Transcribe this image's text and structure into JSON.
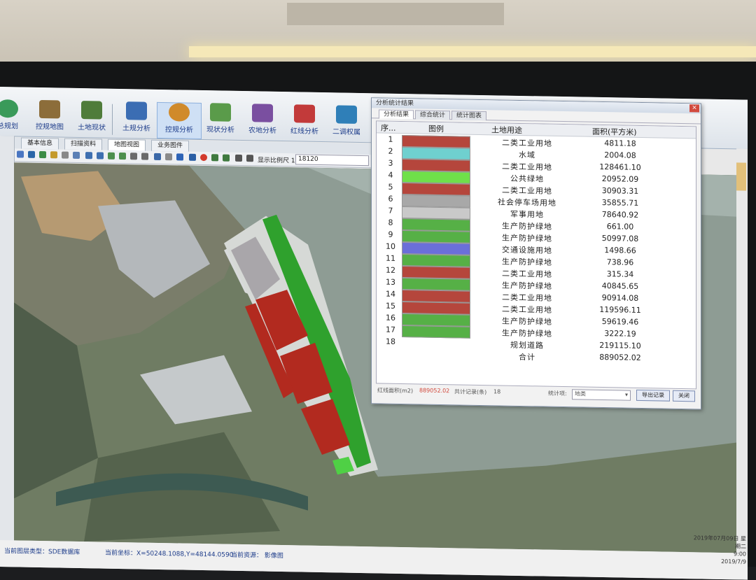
{
  "ribbon": {
    "buttons": [
      {
        "label": "总规划",
        "color": "#3a9a5a"
      },
      {
        "label": "控规地图",
        "color": "#8c6d3a"
      },
      {
        "label": "土地现状",
        "color": "#4f7c3a"
      },
      {
        "label": "土规分析",
        "color": "#3b6db3"
      },
      {
        "label": "控规分析",
        "color": "#d08a2b"
      },
      {
        "label": "现状分析",
        "color": "#5a9b4a"
      },
      {
        "label": "农地分析",
        "color": "#7a4fa0"
      },
      {
        "label": "红线分析",
        "color": "#c23a3a"
      },
      {
        "label": "二调权属",
        "color": "#2f7fb8"
      }
    ]
  },
  "tabs": [
    "基本信息",
    "扫描资料",
    "地图视图",
    "业务图件"
  ],
  "toolbar": {
    "scale_label": "显示比例尺 1:",
    "scale_value": "18120"
  },
  "dialog": {
    "title": "分析统计结果",
    "tabs": [
      "分析结果",
      "综合统计",
      "统计图表"
    ],
    "headers": {
      "seq": "序...",
      "legend": "图例",
      "use": "土地用途",
      "area": "面积(平方米)"
    },
    "rows": [
      {
        "seq": "1",
        "use": "二类工业用地",
        "area": "4811.18",
        "color": "#b5463c"
      },
      {
        "seq": "2",
        "use": "水域",
        "area": "2004.08",
        "color": "#6fd0cf"
      },
      {
        "seq": "3",
        "use": "二类工业用地",
        "area": "128461.10",
        "color": "#b5463c"
      },
      {
        "seq": "4",
        "use": "公共绿地",
        "area": "20952.09",
        "color": "#6fe04a"
      },
      {
        "seq": "5",
        "use": "二类工业用地",
        "area": "30903.31",
        "color": "#b5463c"
      },
      {
        "seq": "6",
        "use": "社会停车场用地",
        "area": "35855.71",
        "color": "#a8a8a8"
      },
      {
        "seq": "7",
        "use": "军事用地",
        "area": "78640.92",
        "color": "#c9c9c9"
      },
      {
        "seq": "8",
        "use": "生产防护绿地",
        "area": "661.00",
        "color": "#56b046"
      },
      {
        "seq": "9",
        "use": "生产防护绿地",
        "area": "50997.08",
        "color": "#56b046"
      },
      {
        "seq": "10",
        "use": "交通设施用地",
        "area": "1498.66",
        "color": "#6b6fd9"
      },
      {
        "seq": "11",
        "use": "生产防护绿地",
        "area": "738.96",
        "color": "#56b046"
      },
      {
        "seq": "12",
        "use": "二类工业用地",
        "area": "315.34",
        "color": "#b5463c"
      },
      {
        "seq": "13",
        "use": "生产防护绿地",
        "area": "40845.65",
        "color": "#56b046"
      },
      {
        "seq": "14",
        "use": "二类工业用地",
        "area": "90914.08",
        "color": "#b5463c"
      },
      {
        "seq": "15",
        "use": "二类工业用地",
        "area": "119596.11",
        "color": "#b5463c"
      },
      {
        "seq": "16",
        "use": "生产防护绿地",
        "area": "59619.46",
        "color": "#56b046"
      },
      {
        "seq": "17",
        "use": "生产防护绿地",
        "area": "3222.19",
        "color": "#56b046"
      },
      {
        "seq": "18",
        "use": "规划道路",
        "area": "219115.10",
        "color": ""
      },
      {
        "seq": "",
        "use": "合计",
        "area": "889052.02",
        "color": ""
      }
    ],
    "footer": {
      "left1": "红线面积(m2)",
      "left2": "889052.02",
      "left3": "共计记录(条)",
      "left4": "18",
      "stat_label": "统计项:",
      "stat_value": "地类",
      "export_label": "导出记录",
      "close_label": "关闭"
    }
  },
  "status": {
    "mode": "当前图层类型：SDE数据库",
    "coords": "当前坐标：X=50248.1088,Y=48144.0590",
    "layer": "当前资源：  影像图"
  },
  "clock": {
    "date": "2019年07月09日 星期二",
    "time": "9:00",
    "date2": "2019/7/9"
  },
  "map": {
    "water": "#8a9a92",
    "land": "#6d7c5f"
  }
}
